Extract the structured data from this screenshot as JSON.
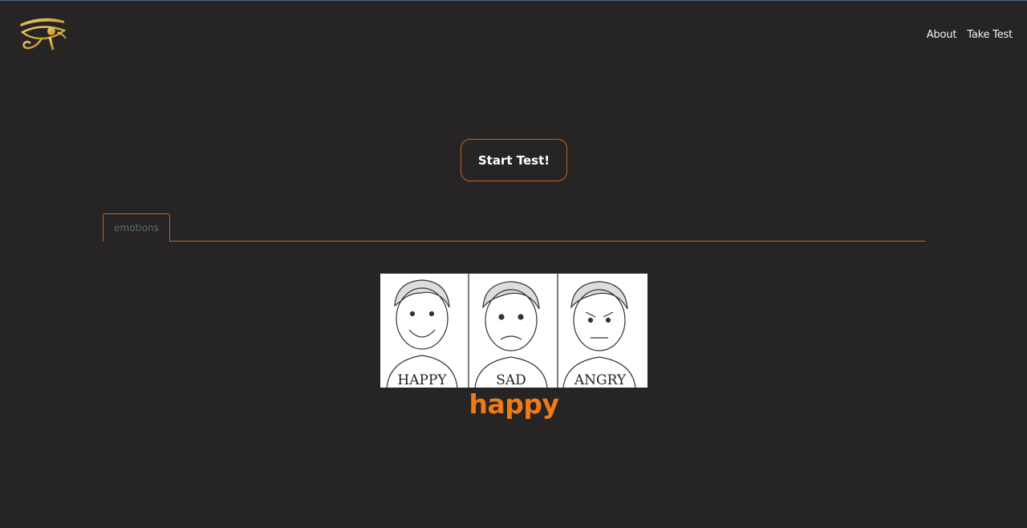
{
  "header": {
    "logo_icon": "eye-of-horus-icon",
    "nav": {
      "about": "About",
      "take_test": "Take Test"
    }
  },
  "main": {
    "start_button": "Start Test!",
    "tabs": [
      {
        "label": "emotions"
      }
    ],
    "image": {
      "captions": [
        "HAPPY",
        "SAD",
        "ANGRY"
      ]
    },
    "answer": "happy"
  },
  "colors": {
    "background": "#262425",
    "accent": "#c8661a",
    "answer": "#f07a16"
  }
}
